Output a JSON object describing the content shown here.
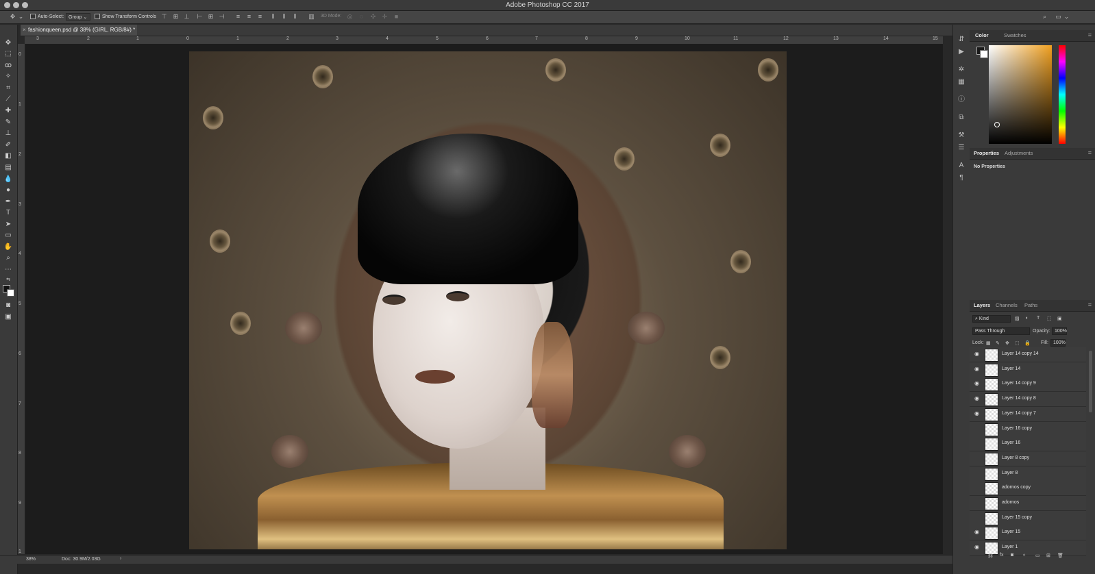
{
  "app": {
    "title": "Adobe Photoshop CC 2017"
  },
  "options_bar": {
    "auto_select_label": "Auto-Select:",
    "auto_select_value": "Group",
    "transform_label": "Show Transform Controls",
    "mode_3d_label": "3D Mode:"
  },
  "document": {
    "tab_title": "fashionqueen.psd @ 38% (GIRL, RGB/8#) *",
    "zoom": "38%",
    "doc_size": "Doc: 30.9M/2.03G"
  },
  "ruler": {
    "h_labels": [
      "3",
      "2",
      "1",
      "0",
      "1",
      "2",
      "3",
      "4",
      "5",
      "6",
      "7",
      "8",
      "9",
      "10",
      "11",
      "12",
      "13",
      "14",
      "15"
    ],
    "v_labels": [
      "0",
      "1",
      "2",
      "3",
      "4",
      "5",
      "6",
      "7",
      "8",
      "9",
      "1"
    ]
  },
  "color_panel": {
    "tabs": [
      "Color",
      "Swatches"
    ]
  },
  "properties_panel": {
    "tabs": [
      "Properties",
      "Adjustments"
    ],
    "message": "No Properties"
  },
  "layers_panel": {
    "tabs": [
      "Layers",
      "Channels",
      "Paths"
    ],
    "filter_kind": "Kind",
    "blend_mode": "Pass Through",
    "opacity_label": "Opacity:",
    "opacity_value": "100%",
    "lock_label": "Lock:",
    "fill_label": "Fill:",
    "fill_value": "100%",
    "layers": [
      {
        "name": "Layer 14 copy 14",
        "visible": true
      },
      {
        "name": "Layer 14",
        "visible": true
      },
      {
        "name": "Layer 14 copy 9",
        "visible": true
      },
      {
        "name": "Layer 14 copy 8",
        "visible": true
      },
      {
        "name": "Layer 14 copy 7",
        "visible": true
      },
      {
        "name": "Layer 16 copy",
        "visible": false
      },
      {
        "name": "Layer 16",
        "visible": false
      },
      {
        "name": "Layer 8 copy",
        "visible": false
      },
      {
        "name": "Layer 8",
        "visible": false
      },
      {
        "name": "adornos copy",
        "visible": false
      },
      {
        "name": "adornos",
        "visible": false
      },
      {
        "name": "Layer 15 copy",
        "visible": false
      },
      {
        "name": "Layer 15",
        "visible": true
      },
      {
        "name": "Layer 1",
        "visible": true
      }
    ]
  },
  "icons": {
    "eye": "◉",
    "close": "×"
  }
}
